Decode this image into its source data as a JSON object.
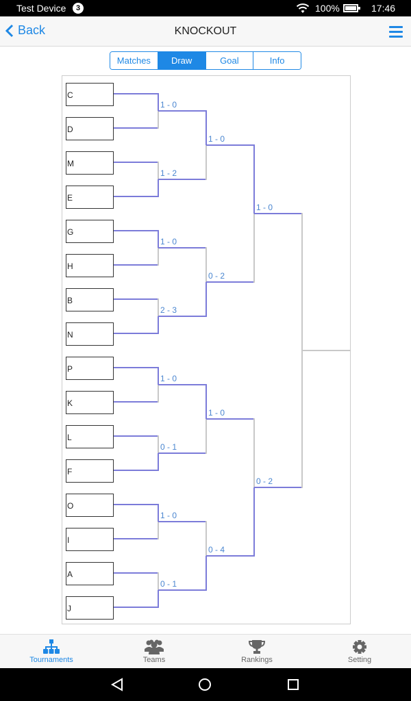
{
  "status_bar": {
    "device_name": "Test Device",
    "notification_count": "3",
    "battery": "100%",
    "time": "17:46"
  },
  "navbar": {
    "back_label": "Back",
    "title": "KNOCKOUT"
  },
  "segments": [
    {
      "label": "Matches",
      "active": false
    },
    {
      "label": "Draw",
      "active": true
    },
    {
      "label": "Goal",
      "active": false
    },
    {
      "label": "Info",
      "active": false
    }
  ],
  "colors": {
    "accent": "#1e88e5",
    "winner_line": "#7b7bd9",
    "loser_line": "#c8c8c8",
    "score_text": "#4a86d0"
  },
  "bracket": {
    "teams": [
      "C",
      "D",
      "M",
      "E",
      "G",
      "H",
      "B",
      "N",
      "P",
      "K",
      "L",
      "F",
      "O",
      "I",
      "A",
      "J"
    ],
    "rounds": [
      [
        {
          "score": "1 - 0",
          "winner": "top"
        },
        {
          "score": "1 - 2",
          "winner": "bottom"
        },
        {
          "score": "1 - 0",
          "winner": "top"
        },
        {
          "score": "2 - 3",
          "winner": "bottom"
        },
        {
          "score": "1 - 0",
          "winner": "top"
        },
        {
          "score": "0 - 1",
          "winner": "bottom"
        },
        {
          "score": "1 - 0",
          "winner": "top"
        },
        {
          "score": "0 - 1",
          "winner": "bottom"
        }
      ],
      [
        {
          "score": "1 - 0",
          "winner": "top"
        },
        {
          "score": "0 - 2",
          "winner": "bottom"
        },
        {
          "score": "1 - 0",
          "winner": "top"
        },
        {
          "score": "0 - 4",
          "winner": "bottom"
        }
      ],
      [
        {
          "score": "1 - 0",
          "winner": "top"
        },
        {
          "score": "0 - 2",
          "winner": "bottom"
        }
      ],
      [
        {
          "score": "",
          "winner": "none"
        }
      ]
    ]
  },
  "tabbar": [
    {
      "label": "Tournaments",
      "icon": "hierarchy-icon",
      "active": true
    },
    {
      "label": "Teams",
      "icon": "users-icon",
      "active": false
    },
    {
      "label": "Rankings",
      "icon": "trophy-icon",
      "active": false
    },
    {
      "label": "Setting",
      "icon": "gear-icon",
      "active": false
    }
  ]
}
